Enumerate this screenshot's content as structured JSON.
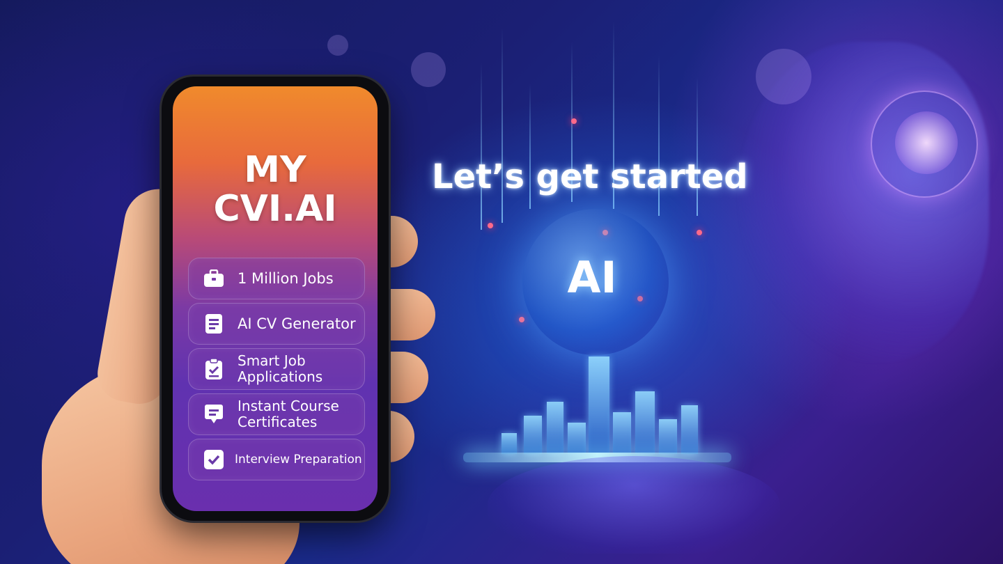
{
  "headline": "Let’s get started",
  "center_label": "AI",
  "phone": {
    "app_title_line1": "MY",
    "app_title_line2": "CVI.AI",
    "features": [
      {
        "label": "1 Million Jobs",
        "icon": "briefcase-icon"
      },
      {
        "label": "AI CV Generator",
        "icon": "document-icon"
      },
      {
        "label": "Smart Job Applications",
        "icon": "clipboard-check-icon"
      },
      {
        "label": "Instant Course Certificates",
        "icon": "chat-bubble-icon"
      },
      {
        "label": "Interview Preparation",
        "icon": "checkbox-icon"
      }
    ]
  },
  "colors": {
    "screen_top": "#f08a2c",
    "screen_bottom": "#6a2fae",
    "background": "#1b1f74"
  }
}
